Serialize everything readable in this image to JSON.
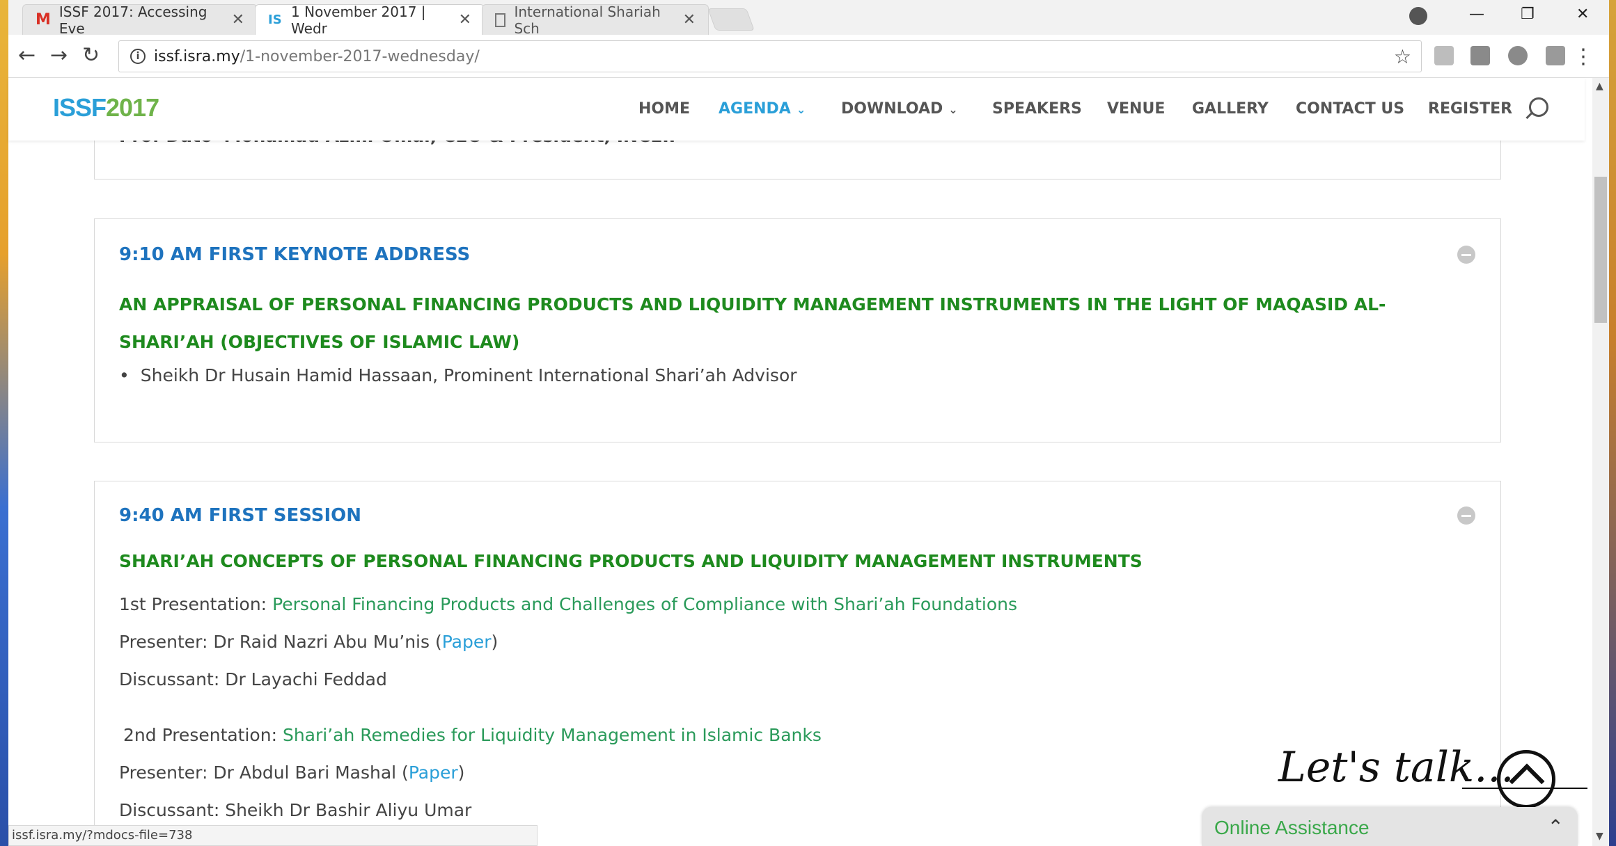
{
  "browser": {
    "tabs": [
      {
        "title": "ISSF 2017: Accessing Eve",
        "favicon": "gmail-icon"
      },
      {
        "title": "1 November 2017 | Wedr",
        "favicon": "isra-icon"
      },
      {
        "title": "International Shariah Sch",
        "favicon": "page-icon"
      }
    ],
    "url_domain": "issf.isra.my",
    "url_path": "/1-november-2017-wednesday/",
    "status_bar": "issf.isra.my/?mdocs-file=738"
  },
  "site": {
    "logo_a": "ISSF",
    "logo_b": "2017",
    "nav": [
      "HOME",
      "AGENDA",
      "DOWNLOAD",
      "SPEAKERS",
      "VENUE",
      "GALLERY",
      "CONTACT US",
      "REGISTER"
    ],
    "active_nav": "AGENDA"
  },
  "agenda": {
    "cut_line": "Prof Dato' Mohamad Azmi Omar, CEO & President, INCEIF",
    "keynote": {
      "time": "9:10 AM FIRST KEYNOTE ADDRESS",
      "title": "AN APPRAISAL OF PERSONAL FINANCING PRODUCTS AND LIQUIDITY MANAGEMENT INSTRUMENTS IN THE LIGHT OF MAQASID AL-SHARI’AH (OBJECTIVES OF ISLAMIC LAW)",
      "speaker": "Sheikh Dr Husain Hamid Hassaan, Prominent International Shari’ah Advisor"
    },
    "session": {
      "time": "9:40 AM FIRST SESSION",
      "title": "SHARI’AH CONCEPTS OF PERSONAL FINANCING PRODUCTS AND LIQUIDITY MANAGEMENT INSTRUMENTS",
      "p1_label": "1st Presentation: ",
      "p1_title": "Personal Financing Products and Challenges of Compliance with Shari’ah Foundations",
      "p1_presenter": "Presenter: Dr Raid Nazri Abu Mu’nis (",
      "p1_paper": "Paper",
      "p1_close": ")",
      "p1_discussant": "Discussant: Dr Layachi Feddad",
      "p2_label": "2nd Presentation: ",
      "p2_title": "Shari’ah Remedies for Liquidity Management in Islamic Banks",
      "p2_presenter": "Presenter: Dr Abdul Bari Mashal (",
      "p2_paper": "Paper",
      "p2_close": ")",
      "p2_discussant": "Discussant: Sheikh Dr Bashir Aliyu Umar"
    }
  },
  "widget": {
    "lets_talk": "Let's talk...",
    "online_assistance": "Online Assistance"
  },
  "colors": {
    "accent": "#2a9fd8",
    "time_blue": "#1e73be",
    "title_green": "#1e8a1e",
    "link_green": "#2a9a5a",
    "logo_green": "#6fb34a"
  }
}
